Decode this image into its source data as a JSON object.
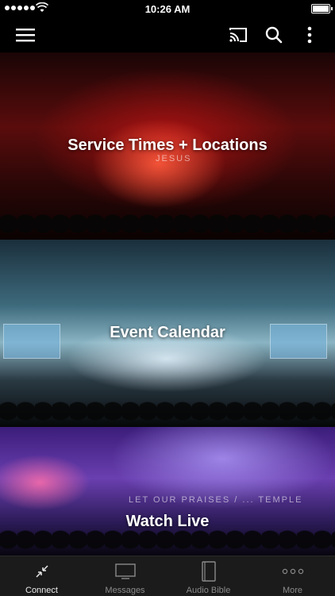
{
  "status_bar": {
    "time": "10:26 AM"
  },
  "tiles": [
    {
      "title": "Service Times + Locations",
      "stage_text": "JESUS"
    },
    {
      "title": "Event Calendar"
    },
    {
      "title": "Watch Live",
      "stage_text": "LET OUR PRAISES / ... TEMPLE"
    }
  ],
  "tab_bar": {
    "tabs": [
      {
        "label": "Connect",
        "icon": "connect-icon",
        "active": true
      },
      {
        "label": "Messages",
        "icon": "tv-icon"
      },
      {
        "label": "Audio Bible",
        "icon": "book-icon"
      },
      {
        "label": "More",
        "icon": "more-dots-icon"
      }
    ]
  },
  "colors": {
    "tab_active": "#e9e9e9",
    "tab_inactive": "#8a8a8a",
    "tab_bar_bg": "#1b1b1b"
  }
}
